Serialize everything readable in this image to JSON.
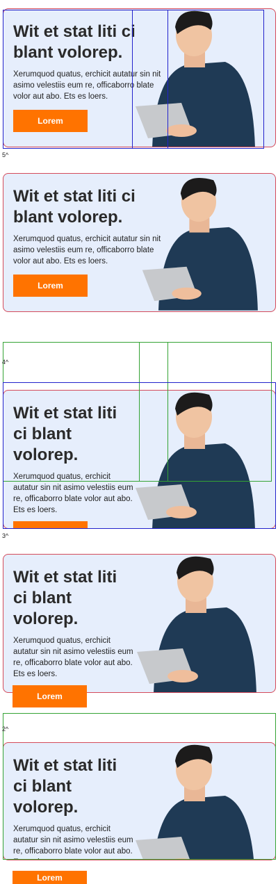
{
  "cards": [
    {
      "title": "Wit et stat liti ci blant volorep.",
      "body": "Xerumquod quatus, erchicit autatur sin nit asimo velestiis eum re, officaborro blate volor aut abo. Ets es loers.",
      "button": "Lorem"
    },
    {
      "title": "Wit et stat liti ci blant volorep.",
      "body": "Xerumquod quatus, erchicit autatur sin nit asimo velestiis eum re, officaborro blate volor aut abo. Ets es loers.",
      "button": "Lorem"
    },
    {
      "title": "Wit et stat liti ci blant volorep.",
      "body": "Xerumquod quatus, erchicit autatur sin nit asimo velestiis eum re, officaborro blate volor aut abo. Ets es loers.",
      "button": "Lorem"
    },
    {
      "title": "Wit et stat liti ci blant volorep.",
      "body": "Xerumquod quatus, erchicit autatur sin nit asimo velestiis eum re, officaborro blate volor aut abo. Ets es loers.",
      "button": "Lorem"
    },
    {
      "title": "Wit et stat liti ci blant volorep.",
      "body": "Xerumquod quatus, erchicit autatur sin nit asimo velestiis eum re, officaborro blate volor aut abo. Ets es loers.",
      "button": "Lorem"
    }
  ],
  "breakpoint_labels": [
    "5^",
    "4^",
    "3^",
    "2^"
  ],
  "colors": {
    "card_bg": "#e6eefc",
    "accent": "#ff7300",
    "outline_red": "#d44a5a",
    "outline_blue": "#2222cc",
    "outline_green": "#34a334"
  }
}
